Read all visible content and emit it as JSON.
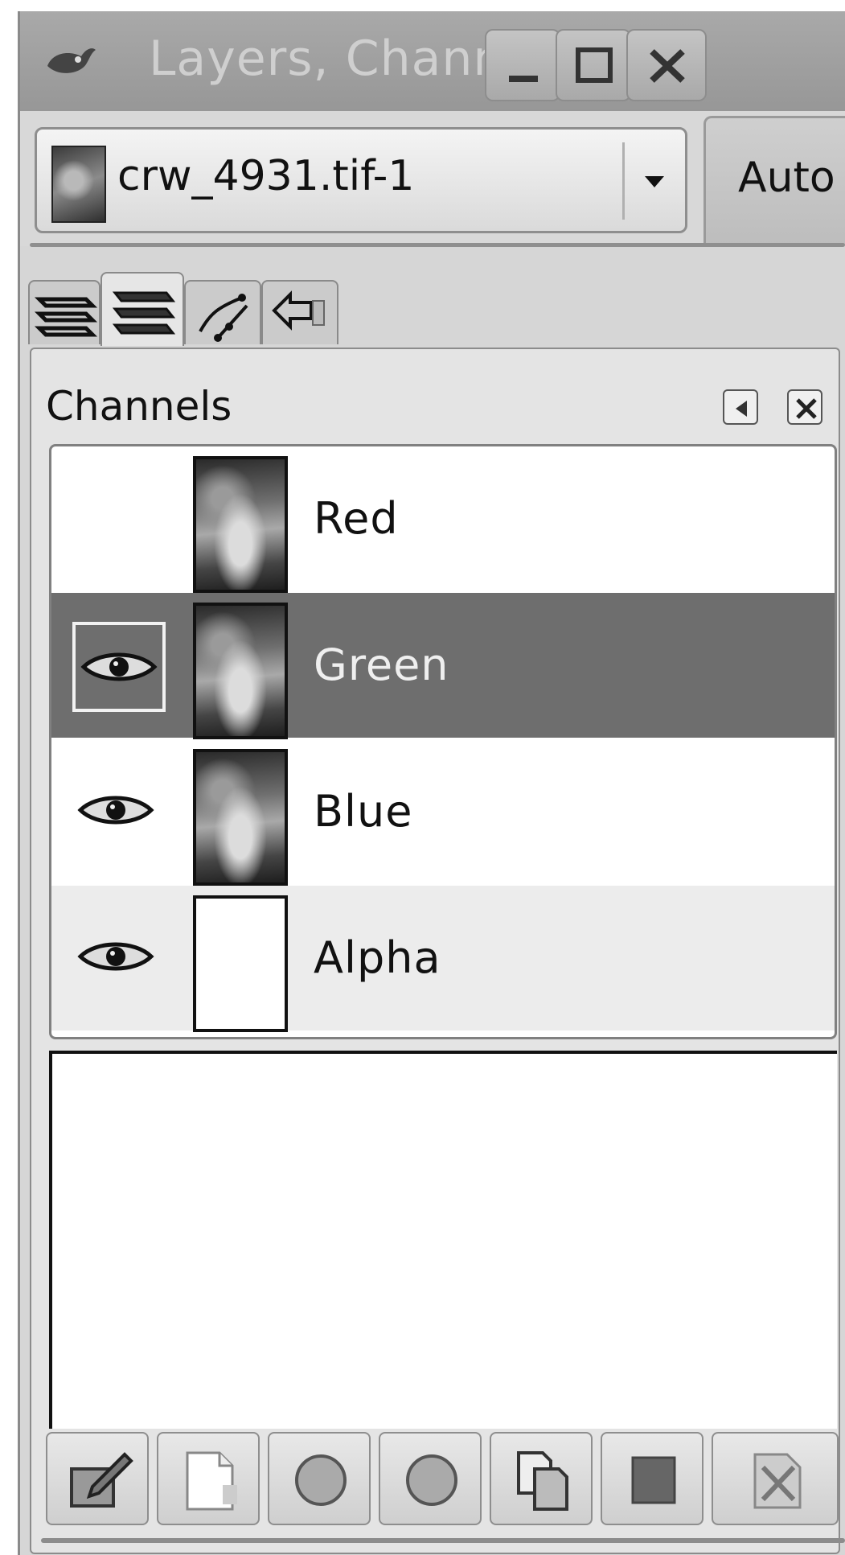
{
  "window": {
    "title": "Layers, Channe",
    "controls": [
      "minimize",
      "maximize",
      "close"
    ]
  },
  "image_selector": {
    "value": "crw_4931.tif-1",
    "auto_label": "Auto"
  },
  "tabs": [
    {
      "name": "layers",
      "icon": "layers-icon",
      "active": false
    },
    {
      "name": "channels",
      "icon": "channels-icon",
      "active": true
    },
    {
      "name": "paths",
      "icon": "paths-icon",
      "active": false
    },
    {
      "name": "undo-history",
      "icon": "undo-history-icon",
      "active": false
    }
  ],
  "panel": {
    "title": "Channels",
    "menu_icon": "tab-menu-icon",
    "close_icon": "close-tab-icon"
  },
  "channels": [
    {
      "label": "Red",
      "visible": false,
      "selected": false,
      "thumb": "photo"
    },
    {
      "label": "Green",
      "visible": true,
      "selected": true,
      "thumb": "photo"
    },
    {
      "label": "Blue",
      "visible": true,
      "selected": false,
      "thumb": "photo"
    },
    {
      "label": "Alpha",
      "visible": true,
      "selected": false,
      "thumb": "blank"
    }
  ],
  "bottom_buttons": [
    {
      "name": "edit-channel-attributes",
      "icon": "pencil-icon",
      "enabled": false
    },
    {
      "name": "new-channel",
      "icon": "new-page-icon",
      "enabled": true
    },
    {
      "name": "raise-channel",
      "icon": "raise-icon",
      "enabled": false
    },
    {
      "name": "lower-channel",
      "icon": "lower-icon",
      "enabled": false
    },
    {
      "name": "duplicate-channel",
      "icon": "duplicate-icon",
      "enabled": false
    },
    {
      "name": "channel-to-selection",
      "icon": "selection-icon",
      "enabled": false
    },
    {
      "name": "delete-channel",
      "icon": "delete-icon",
      "enabled": false
    }
  ]
}
